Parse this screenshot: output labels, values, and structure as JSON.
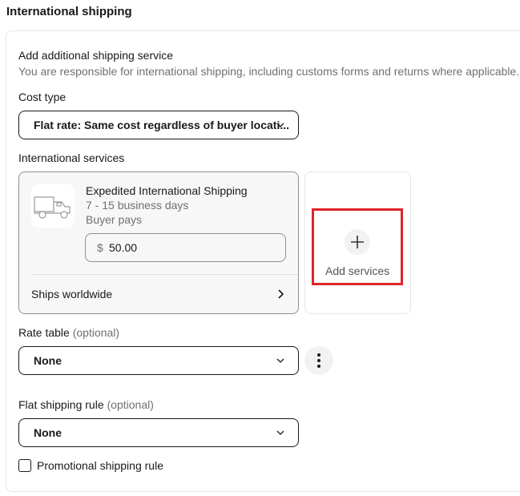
{
  "section_title": "International shipping",
  "panel": {
    "heading": "Add additional shipping service",
    "description": "You are responsible for international shipping, including customs forms and returns where applicable.",
    "cost_type": {
      "label": "Cost type",
      "value": "Flat rate: Same cost regardless of buyer locati..."
    },
    "international_services": {
      "label": "International services",
      "service": {
        "icon": "truck-icon",
        "name": "Expedited International Shipping",
        "delivery_time": "7 - 15 business days",
        "payer": "Buyer pays",
        "currency_symbol": "$",
        "price": "50.00",
        "ships_to": "Ships worldwide"
      },
      "add_button": {
        "icon": "plus-icon",
        "label": "Add services",
        "highlight_color": "#e0232b"
      }
    },
    "rate_table": {
      "label": "Rate table",
      "optional": "(optional)",
      "value": "None"
    },
    "flat_shipping_rule": {
      "label": "Flat shipping rule",
      "optional": "(optional)",
      "value": "None"
    },
    "promotional_rule": {
      "label": "Promotional shipping rule",
      "checked": false
    }
  }
}
